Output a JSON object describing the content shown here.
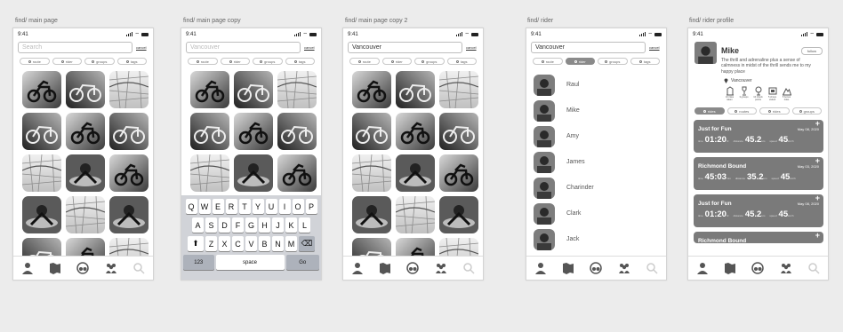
{
  "colors": {
    "canvas": "#ececec",
    "card": "#7a7a7a",
    "chip_active": "#8a8a8a"
  },
  "screens": [
    {
      "label": "find/ main page",
      "time": "9:41",
      "search_value": "",
      "search_placeholder": "Search",
      "cancel": "cancel",
      "chips": [
        {
          "label": "route"
        },
        {
          "label": "rider"
        },
        {
          "label": "groups"
        },
        {
          "label": "tags"
        }
      ],
      "active_chip": -1
    },
    {
      "label": "find/ main page  copy",
      "time": "9:41",
      "search_value": "",
      "search_placeholder": "Vancouver",
      "cancel": "cancel",
      "chips": [
        {
          "label": "route"
        },
        {
          "label": "rider"
        },
        {
          "label": "groups"
        },
        {
          "label": "tags"
        }
      ],
      "active_chip": -1
    },
    {
      "label": "find/ main page  copy 2",
      "time": "9:41",
      "search_value": "Vancouver",
      "search_placeholder": "",
      "cancel": "cancel",
      "chips": [
        {
          "label": "route"
        },
        {
          "label": "rider"
        },
        {
          "label": "groups"
        },
        {
          "label": "tags"
        }
      ],
      "active_chip": -1
    },
    {
      "label": "find/ rider",
      "time": "9:41",
      "search_value": "Vancouver",
      "search_placeholder": "",
      "cancel": "cancel",
      "chips": [
        {
          "label": "route"
        },
        {
          "label": "rider"
        },
        {
          "label": "groups"
        },
        {
          "label": "tags"
        }
      ],
      "active_chip": 1
    },
    {
      "label": "find/ rider profile",
      "time": "9:41"
    }
  ],
  "keyboard": {
    "row1": [
      "Q",
      "W",
      "E",
      "R",
      "T",
      "Y",
      "U",
      "I",
      "O",
      "P"
    ],
    "row2": [
      "A",
      "S",
      "D",
      "F",
      "G",
      "H",
      "J",
      "K",
      "L"
    ],
    "row3": [
      "Z",
      "X",
      "C",
      "V",
      "B",
      "N",
      "M"
    ],
    "k123": "123",
    "space": "space",
    "go": "Go"
  },
  "riders": [
    "Raul",
    "Mike",
    "Amy",
    "James",
    "Charinder",
    "Clark",
    "Jack"
  ],
  "profile": {
    "name": "Mike",
    "follow": "follow",
    "bio": "The thrill and adrenaline plus a sense of calmness in midst of the thrill sends me to my happy place",
    "location": "Vancouver",
    "badges": [
      "10 rides taken",
      "3 groups",
      "10 check points",
      "5 shops visited",
      "5 bonus rides"
    ],
    "tabs": [
      {
        "label": "rides"
      },
      {
        "label": "routes"
      },
      {
        "label": "rides"
      },
      {
        "label": "groups"
      }
    ],
    "rides": [
      {
        "title": "Just for Fun",
        "date": "May 08, 2020",
        "time": "01:20",
        "distance": "45.2",
        "speed": "45",
        "time_cap": "time",
        "time_unit": "hr",
        "dist_cap": "distance",
        "dist_unit": "km",
        "speed_cap": "speed",
        "speed_unit": "km/h"
      },
      {
        "title": "Richmond Bound",
        "date": "May 03, 2020",
        "time": "45:03",
        "distance": "35.2",
        "speed": "45",
        "time_cap": "time",
        "time_unit": "min",
        "dist_cap": "distance",
        "dist_unit": "km",
        "speed_cap": "speed",
        "speed_unit": "km/h"
      },
      {
        "title": "Just for Fun",
        "date": "May 08, 2020",
        "time": "01:20",
        "distance": "45.2",
        "speed": "45",
        "time_cap": "time",
        "time_unit": "hr",
        "dist_cap": "distance",
        "dist_unit": "km",
        "speed_cap": "speed",
        "speed_unit": "km/h"
      },
      {
        "title": "Richmond Bound"
      }
    ]
  },
  "nav": [
    "profile-icon",
    "map-icon",
    "motorcycle-icon",
    "community-icon",
    "search-icon"
  ]
}
